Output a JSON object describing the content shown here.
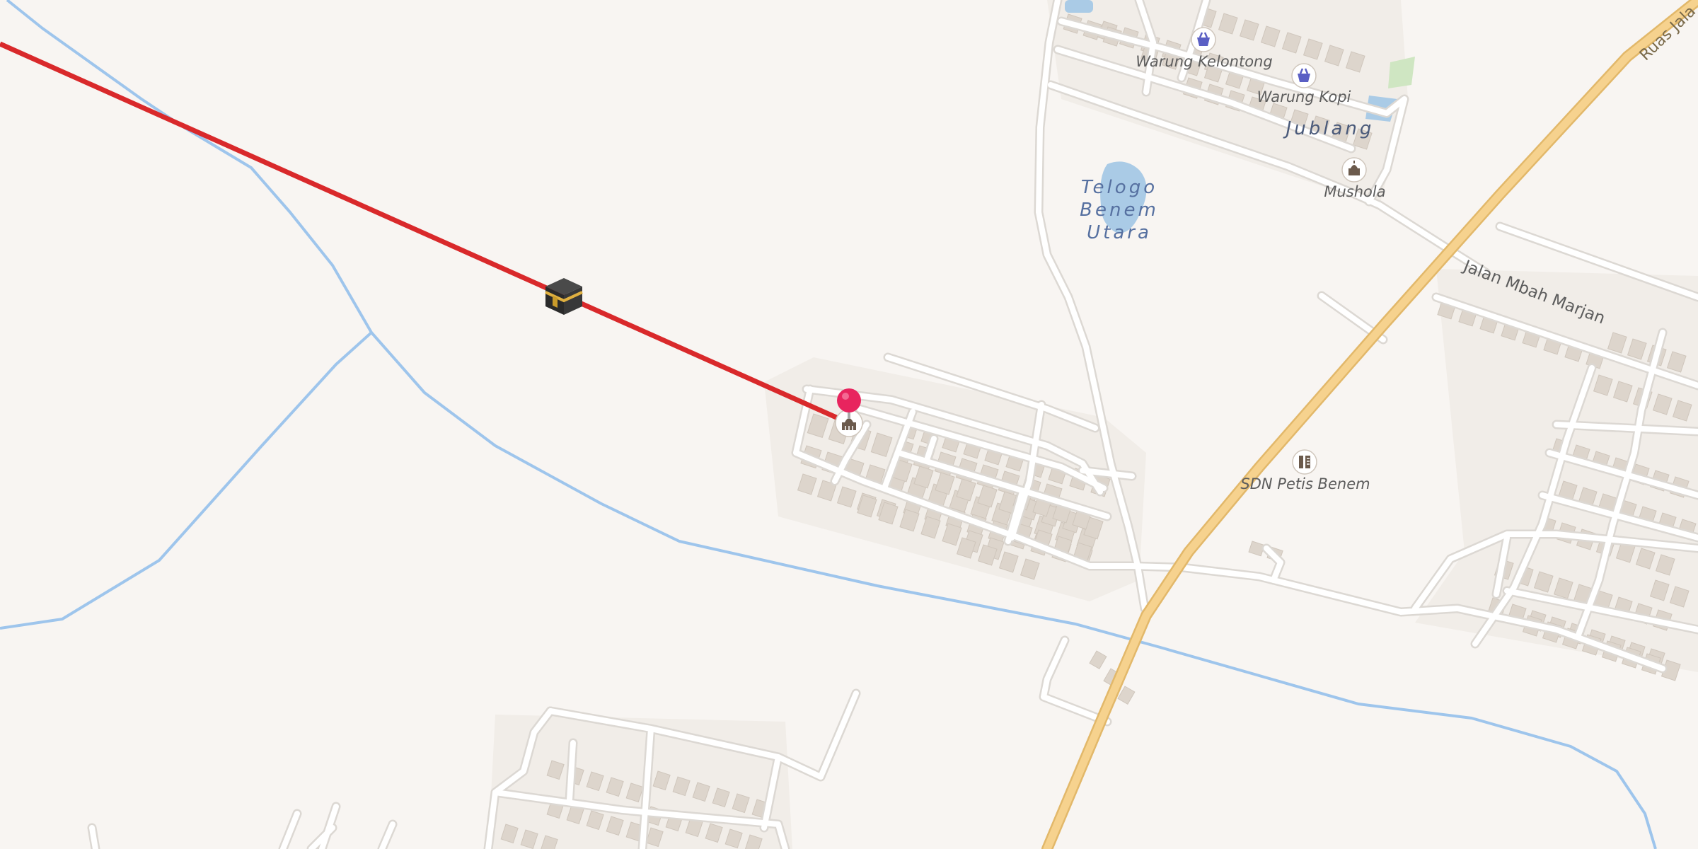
{
  "map": {
    "labels": {
      "warung_kelontong": "Warung Kelontong",
      "warung_kopi": "Warung Kopi",
      "jublang": "Jublang",
      "telogo_line1": "Telogo",
      "telogo_line2": "Benem",
      "telogo_line3": "Utara",
      "mushola": "Mushola",
      "jalan_mbah_marjan": "Jalan Mbah Marjan",
      "sdn_petis_benem": "SDN Petis Benem",
      "ruas_jalan": "Ruas Jala"
    },
    "icons": {
      "kaaba": "kaaba-icon",
      "location_pin": "map-pin-icon",
      "mosque": "mosque-icon",
      "shop": "shopping-basket-icon",
      "school": "school-icon"
    },
    "colors": {
      "background": "#f8f5f2",
      "qibla_line": "#d9292b",
      "river": "#9ec5ec",
      "main_road": "#f6d28e",
      "minor_road": "#ffffff",
      "building": "#ddd5cc",
      "water": "#aacbe6",
      "pin": "#e8245e",
      "poi_shop": "#5a5fc4"
    }
  }
}
